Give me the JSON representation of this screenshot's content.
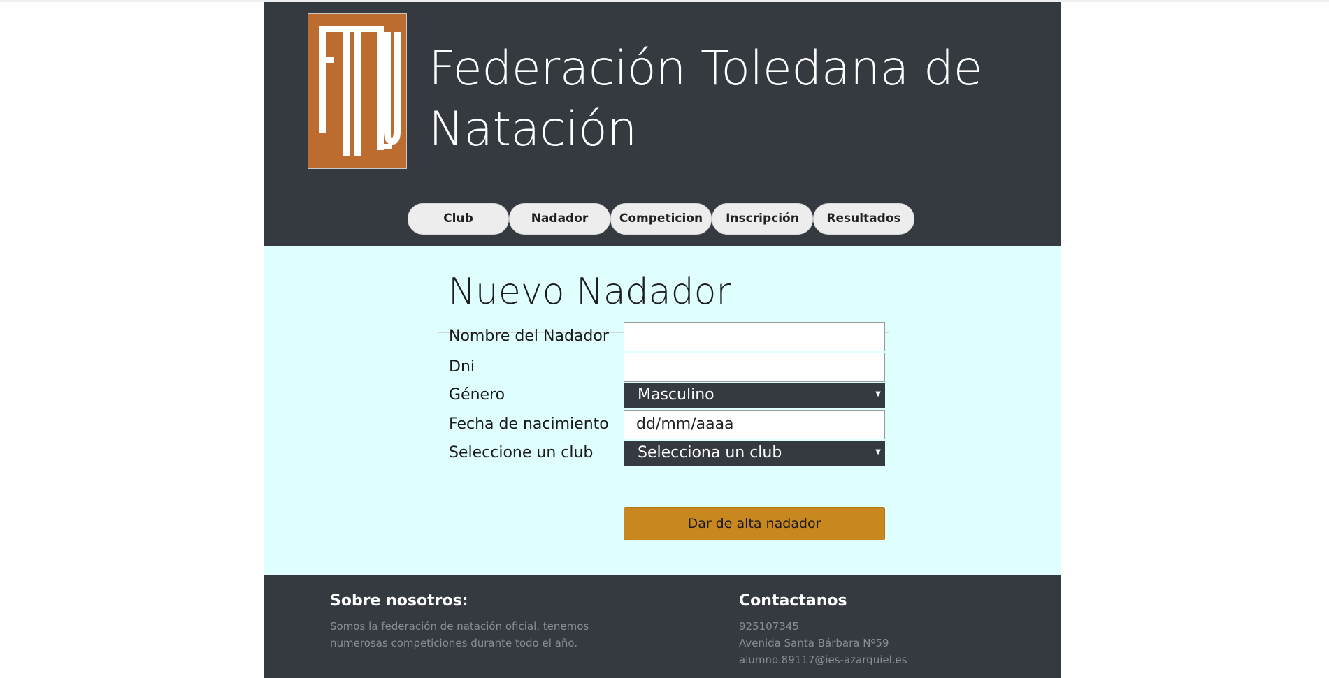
{
  "header": {
    "logo_text": "FTN",
    "title_line1": "Federación Toledana de",
    "title_line2": "Natación"
  },
  "nav": {
    "items": [
      {
        "label": "Club"
      },
      {
        "label": "Nadador"
      },
      {
        "label": "Competicion"
      },
      {
        "label": "Inscripción"
      },
      {
        "label": "Resultados"
      }
    ]
  },
  "form": {
    "title": "Nuevo Nadador",
    "fields": {
      "name_label": "Nombre del Nadador",
      "name_value": "",
      "dni_label": "Dni",
      "dni_value": "",
      "gender_label": "Género",
      "gender_selected": "Masculino",
      "birth_label": "Fecha de nacimiento",
      "birth_placeholder": "dd/mm/aaaa",
      "club_label": "Seleccione un club",
      "club_selected": "Selecciona un club"
    },
    "submit_label": "Dar de alta nadador"
  },
  "footer": {
    "about_title": "Sobre nosotros:",
    "about_text_line1": "Somos la federación de natación oficial, tenemos",
    "about_text_line2": "numerosas competiciones durante todo el año.",
    "contact_title": "Contactanos",
    "contact_phone": "925107345",
    "contact_address": "Avenida Santa Bárbara Nº59",
    "contact_email": "alumno.89117@ies-azarquiel.es"
  },
  "colors": {
    "header_bg": "#353a41",
    "logo_bg": "#bb6c2e",
    "main_bg": "#dfffff",
    "button_bg": "#c8871f",
    "nav_pill_bg": "#ededed"
  },
  "icons": {
    "select_caret": "caret-down-icon"
  }
}
